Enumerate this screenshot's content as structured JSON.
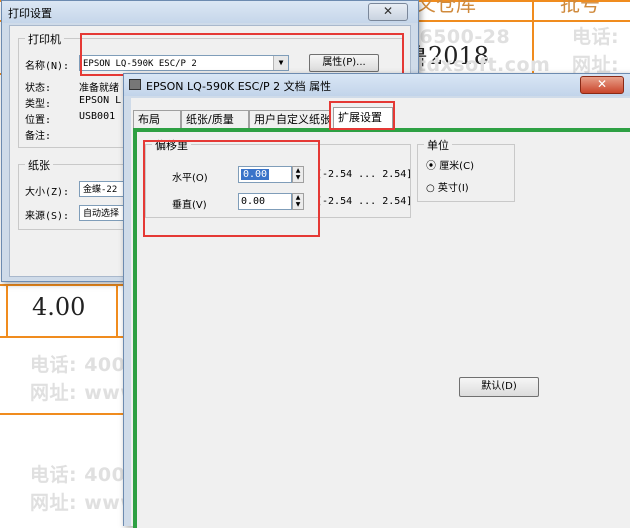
{
  "background": {
    "header_fragments": [
      "义仓库",
      "批号"
    ],
    "cell_text_2018": "鲁2018",
    "cell_value": "4.00",
    "watermark_phone": "电话: 4006-6500-28",
    "watermark_site": "网址: www.tdxsoft.com",
    "wm_short_phone": "电话:",
    "wm_short_site": "网址:"
  },
  "print_dialog": {
    "title": "打印设置",
    "close": "✕",
    "printer_group": "打印机",
    "name_label": "名称(N):",
    "printer_name": "EPSON LQ-590K ESC/P 2",
    "properties_button": "属性(P)...",
    "status_label": "状态:",
    "status_value": "准备就绪",
    "type_label": "类型:",
    "type_value": "EPSON L",
    "location_label": "位置:",
    "location_value": "USB001",
    "comment_label": "备注:",
    "paper_group": "纸张",
    "size_label": "大小(Z):",
    "size_value": "金蝶-22",
    "source_label": "来源(S):",
    "source_value": "自动选择"
  },
  "props_dialog": {
    "title": "EPSON LQ-590K ESC/P 2 文档 属性",
    "close": "✕",
    "tabs": [
      "布局",
      "纸张/质量",
      "用户自定义纸张",
      "扩展设置"
    ],
    "active_tab": "扩展设置",
    "offset_group": "偏移里",
    "horizontal_label": "水平(O)",
    "horizontal_value": "0.00",
    "vertical_label": "垂直(V)",
    "vertical_value": "0.00",
    "range_h": "[-2.54 ... 2.54]",
    "range_v": "[-2.54 ... 2.54]",
    "unit_group": "单位",
    "unit_cm": "厘米(C)",
    "unit_inch": "英寸(I)",
    "default_button": "默认(D)"
  },
  "colors": {
    "grid": "#f08c1e",
    "highlight": "#e53935",
    "green_panel": "#2ea043"
  }
}
